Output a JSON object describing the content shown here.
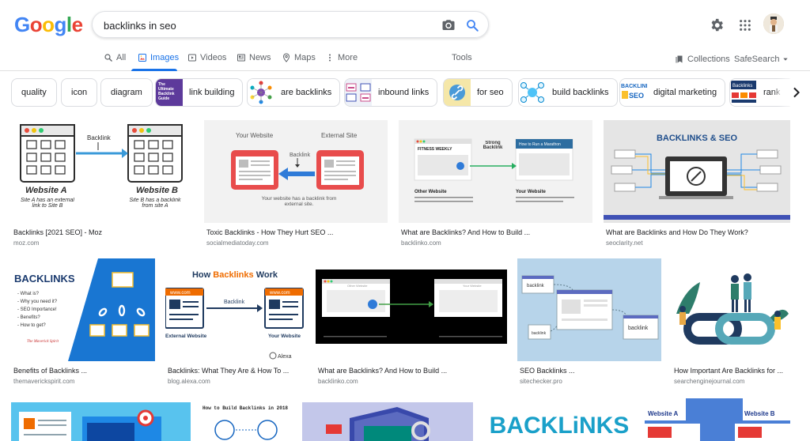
{
  "logo": {
    "letters": [
      "G",
      "o",
      "o",
      "g",
      "l",
      "e"
    ],
    "colors": [
      "#4285F4",
      "#EA4335",
      "#FBBC05",
      "#4285F4",
      "#34A853",
      "#EA4335"
    ]
  },
  "search": {
    "query": "backlinks in seo"
  },
  "tabs": [
    {
      "label": "All",
      "icon": "search-icon"
    },
    {
      "label": "Images",
      "icon": "image-icon"
    },
    {
      "label": "Videos",
      "icon": "play-icon"
    },
    {
      "label": "News",
      "icon": "news-icon"
    },
    {
      "label": "Maps",
      "icon": "map-pin-icon"
    },
    {
      "label": "More",
      "icon": "more-vertical-icon"
    }
  ],
  "tools_label": "Tools",
  "collections_label": "Collections",
  "safesearch_label": "SafeSearch",
  "accent_color": "#1a73e8",
  "chips": [
    {
      "label": "quality"
    },
    {
      "label": "icon"
    },
    {
      "label": "diagram"
    },
    {
      "label": "link building",
      "thumb_text": "The Ultimate Backlink Guide"
    },
    {
      "label": "are backlinks"
    },
    {
      "label": "inbound links"
    },
    {
      "label": "for seo"
    },
    {
      "label": "build backlinks"
    },
    {
      "label": "digital marketing",
      "thumb_text": "BACKLINKS SEO"
    },
    {
      "label": "rank",
      "thumb_text": "Backlinks"
    }
  ],
  "row1": [
    {
      "title": "Backlinks [2021 SEO] - Moz",
      "domain": "moz.com",
      "img": {
        "backlink": "Backlink",
        "site_a": "Website A",
        "site_b": "Website B",
        "caption_a": "Site A has an external link to Site B",
        "caption_b": "Site B has a backlink from site A"
      }
    },
    {
      "title": "Toxic Backlinks - How They Hurt SEO ...",
      "domain": "socialmediatoday.com",
      "img": {
        "your_website": "Your Website",
        "external_site": "External Site",
        "backlink": "Backlink",
        "caption": "Your website has a backlink from external site."
      }
    },
    {
      "title": "What are Backlinks? And How to Build ...",
      "domain": "backlinko.com",
      "img": {
        "fitness": "FITNESS WEEKLY",
        "strong": "Strong Backlink",
        "marathon": "How to Run a Marathon",
        "other_website": "Other Website",
        "your_website": "Your Website"
      }
    },
    {
      "title": "What are Backlinks and How Do They Work?",
      "domain": "seoclarity.net",
      "img": {
        "heading": "BACKLINKS & SEO"
      }
    }
  ],
  "row2": [
    {
      "title": "Benefits of Backlinks ...",
      "domain": "themaverickspirit.com",
      "img": {
        "heading": "BACKLINKS",
        "bullets": [
          "- What is?",
          "- Why you need it?",
          "- SEO Importance!",
          "- Benefits?",
          "- How to get?"
        ],
        "brand": "The Maverick Spirit"
      }
    },
    {
      "title": "Backlinks: What They Are & How To ...",
      "domain": "blog.alexa.com",
      "img": {
        "heading_1": "How ",
        "heading_2": "Backlinks",
        "heading_3": " Work",
        "www": "www.com",
        "backlink": "Backlink",
        "external": "External Website",
        "your": "Your Website",
        "brand": "Alexa"
      }
    },
    {
      "title": "What are Backlinks? And How to Build ...",
      "domain": "backlinko.com",
      "img": {
        "other": "Other Website",
        "yours": "Your Website"
      }
    },
    {
      "title": "SEO Backlinks ...",
      "domain": "sitechecker.pro",
      "img": {
        "label": "backlink"
      }
    },
    {
      "title": "How Important Are Backlinks for ...",
      "domain": "searchenginejournal.com",
      "img": {}
    }
  ],
  "row3": [
    {
      "img": {}
    },
    {
      "img": {
        "heading": "How to Build Backlinks in 2018"
      }
    },
    {
      "img": {}
    },
    {
      "img": {
        "heading": "BACKLiNKS"
      }
    },
    {
      "img": {
        "site_a": "Website A",
        "site_b": "Website B"
      }
    }
  ]
}
